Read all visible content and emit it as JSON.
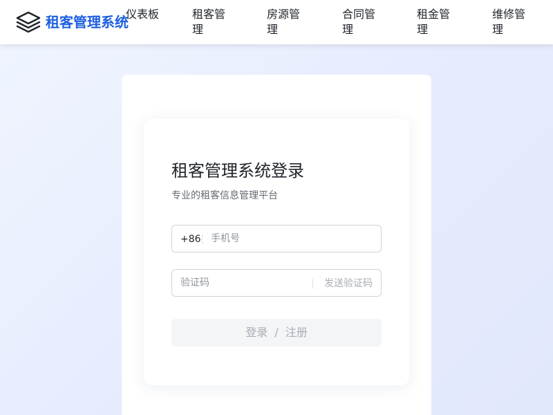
{
  "header": {
    "brand": "租客管理系统",
    "logo_icon": "layers-icon",
    "brand_color": "#1e60e0",
    "nav": [
      {
        "label": "仪表板"
      },
      {
        "label": "租客管理"
      },
      {
        "label": "房源管理"
      },
      {
        "label": "合同管理"
      },
      {
        "label": "租金管理"
      },
      {
        "label": "维修管理"
      }
    ]
  },
  "login": {
    "title": "租客管理系统登录",
    "subtitle": "专业的租客信息管理平台",
    "phone": {
      "prefix": "+86",
      "placeholder": "手机号",
      "value": ""
    },
    "code": {
      "placeholder": "验证码",
      "value": "",
      "send_label": "发送验证码"
    },
    "submit": {
      "login_label": "登录",
      "separator": "/",
      "register_label": "注册"
    }
  }
}
